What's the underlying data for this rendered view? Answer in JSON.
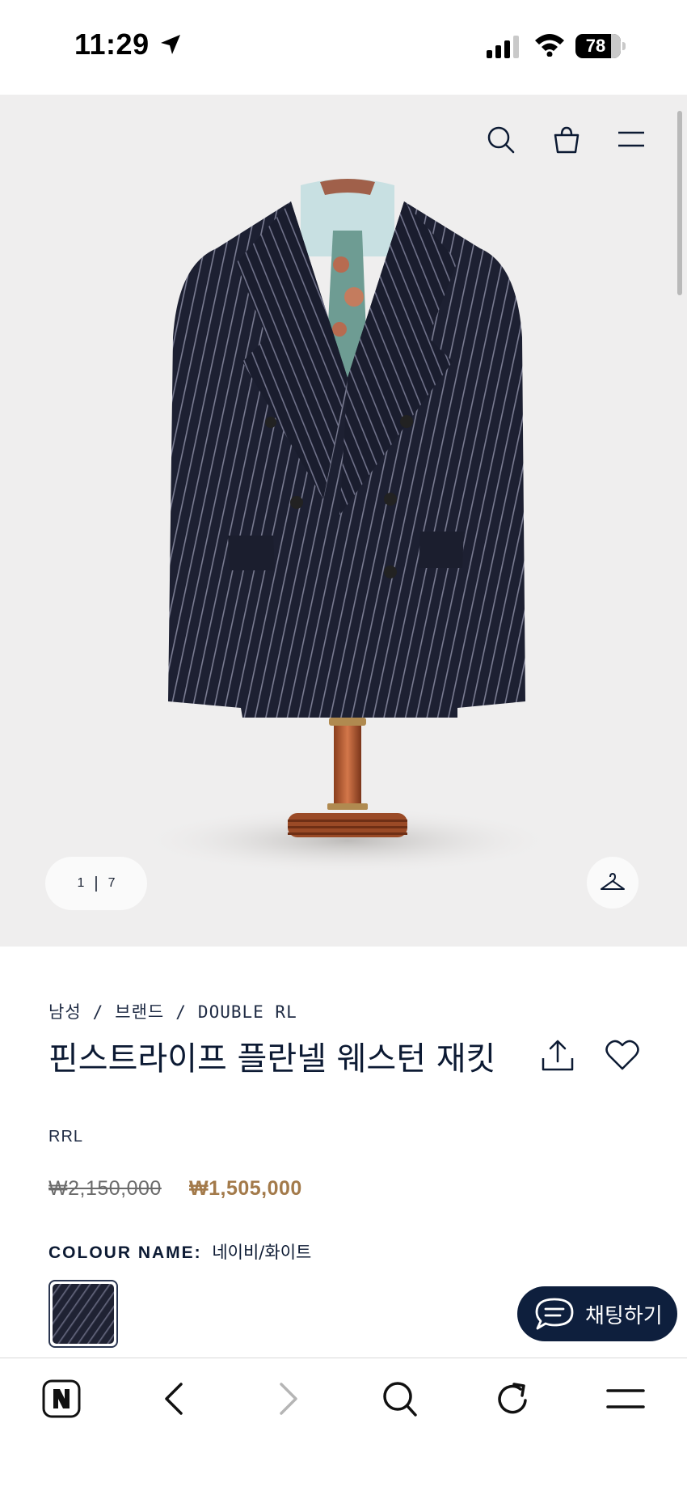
{
  "status_bar": {
    "time": "11:29",
    "battery": "78",
    "battery_level": 0.78
  },
  "product": {
    "image_counter": {
      "current": "1",
      "separator": "|",
      "total": "7"
    },
    "breadcrumb": [
      "남성",
      "브랜드",
      "DOUBLE RL"
    ],
    "title": "핀스트라이프 플란넬 웨스턴 재킷",
    "brand": "RRL",
    "price_original": "₩2,150,000",
    "price_sale": "₩1,505,000",
    "colour_label": "COLOUR NAME:",
    "colour_value": "네이비/화이트"
  },
  "chat": {
    "label": "채팅하기"
  },
  "icons": {
    "header": [
      "search-icon",
      "shopping-bag-icon",
      "menu-icon"
    ],
    "product": [
      "share-icon",
      "heart-icon",
      "hanger-icon"
    ],
    "toolbar": [
      "naver-n-icon",
      "back-icon",
      "forward-icon",
      "search-icon",
      "reload-icon",
      "menu-icon"
    ]
  },
  "colors": {
    "navy": "#0e1f3d",
    "sale_price": "#a37a4a",
    "hero_bg": "#efeeee"
  }
}
